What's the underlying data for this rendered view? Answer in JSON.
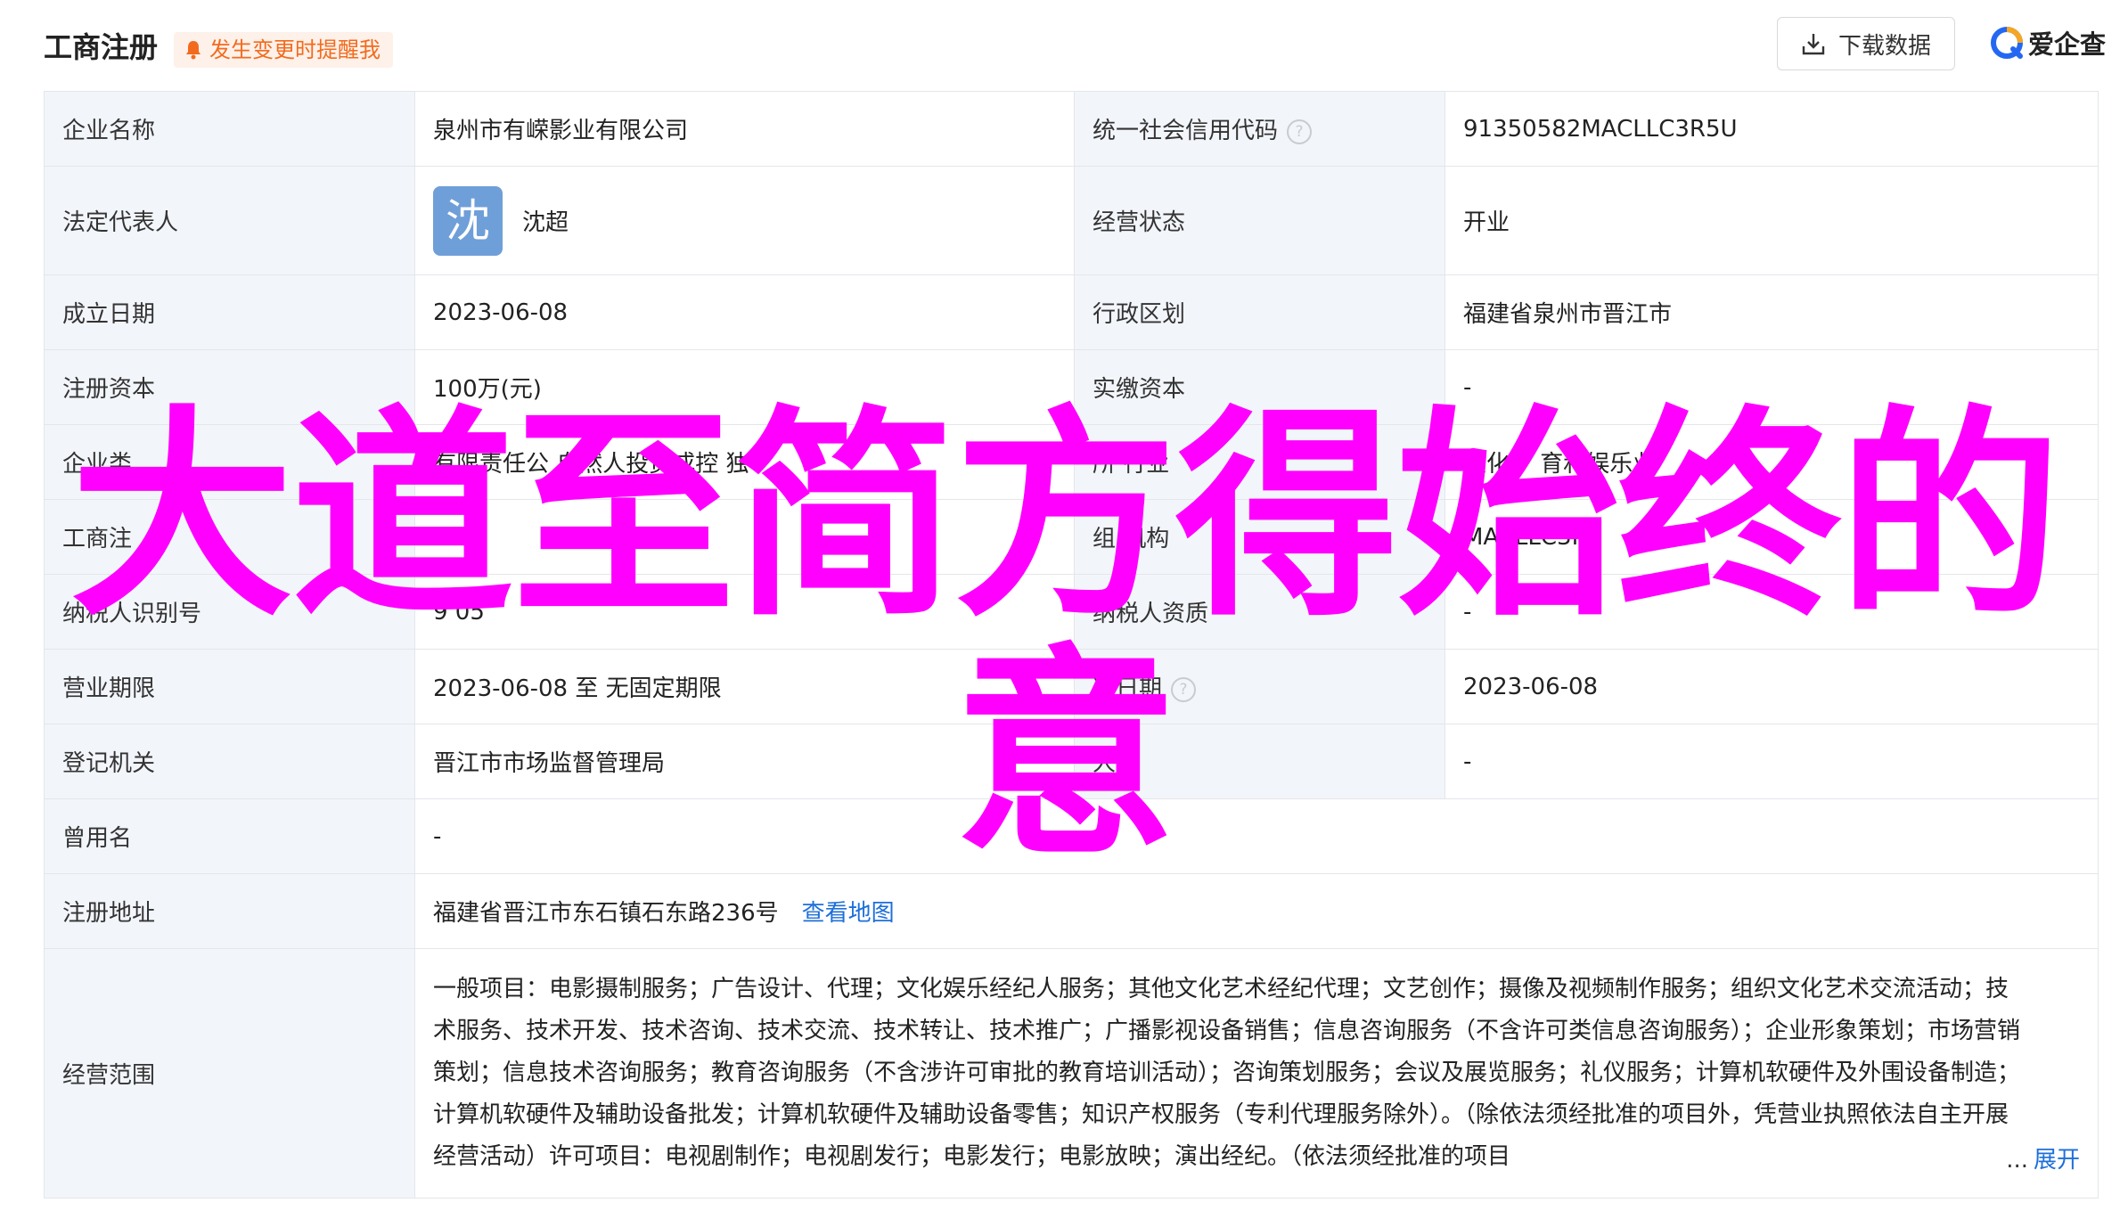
{
  "header": {
    "title": "工商注册",
    "alert_label": "发生变更时提醒我",
    "download_label": "下载数据",
    "brand_name": "爱企查"
  },
  "rows": {
    "company_name": {
      "label": "企业名称",
      "value": "泉州市有嵘影业有限公司"
    },
    "credit_code": {
      "label": "统一社会信用代码",
      "value": "91350582MACLLC3R5U"
    },
    "legal_rep": {
      "label": "法定代表人",
      "avatar_char": "沈",
      "value": "沈超"
    },
    "status": {
      "label": "经营状态",
      "value": "开业"
    },
    "found_date": {
      "label": "成立日期",
      "value": "2023-06-08"
    },
    "region": {
      "label": "行政区划",
      "value": "福建省泉州市晋江市"
    },
    "reg_capital": {
      "label": "注册资本",
      "value": "100万(元)"
    },
    "paid_capital": {
      "label": "实缴资本",
      "value": "-"
    },
    "company_type": {
      "label": "企业类",
      "value": "有限责任公 自然人投资或控 独 "
    },
    "industry": {
      "label": "所 行业",
      "value": "文化、 育和娱乐业"
    },
    "biz_reg_no": {
      "label": "工商注",
      "value": ""
    },
    "org_code": {
      "label": "组 机构",
      "value": "MACLLC3R5"
    },
    "taxpayer_id": {
      "label": "纳税人识别号",
      "value": "9 05"
    },
    "taxpayer_qual": {
      "label": "纳税人资质",
      "value": "-"
    },
    "biz_term": {
      "label": "营业期限",
      "value": "2023-06-08 至 无固定期限"
    },
    "approval_date": {
      "label": "准日期",
      "value": "2023-06-08"
    },
    "authority": {
      "label": "登记机关",
      "value": "晋江市市场监督管理局"
    },
    "staff_count": {
      "label": "人数",
      "value": "-"
    },
    "former_name": {
      "label": "曾用名",
      "value": "-"
    },
    "address": {
      "label": "注册地址",
      "value": "福建省晋江市东石镇石东路236号",
      "map_link": "查看地图"
    },
    "scope": {
      "label": "经营范围",
      "value": "一般项目：电影摄制服务；广告设计、代理；文化娱乐经纪人服务；其他文化艺术经纪代理；文艺创作；摄像及视频制作服务；组织文化艺术交流活动；技术服务、技术开发、技术咨询、技术交流、技术转让、技术推广；广播影视设备销售；信息咨询服务（不含许可类信息咨询服务）；企业形象策划；市场营销策划；信息技术咨询服务；教育咨询服务（不含涉许可审批的教育培训活动）；咨询策划服务；会议及展览服务；礼仪服务；计算机软硬件及外围设备制造；计算机软硬件及辅助设备批发；计算机软硬件及辅助设备零售；知识产权服务（专利代理服务除外）。（除依法须经批准的项目外，凭营业执照依法自主开展经营活动）许可项目：电视剧制作；电视剧发行；电影发行；电影放映；演出经纪。（依法须经批准的项目",
      "ellipsis": "...",
      "expand_label": "展开"
    }
  },
  "watermark": {
    "line1": "大道至简方得始终的",
    "line2": "意"
  },
  "colors": {
    "label_bg": "#f2f5fa",
    "link": "#1e6fd9",
    "alert": "#f26b1d",
    "avatar": "#6f9fd8",
    "watermark": "#ff00ff"
  },
  "icons": [
    "bell-icon",
    "download-icon",
    "brand-logo-icon",
    "help-circle-icon"
  ]
}
